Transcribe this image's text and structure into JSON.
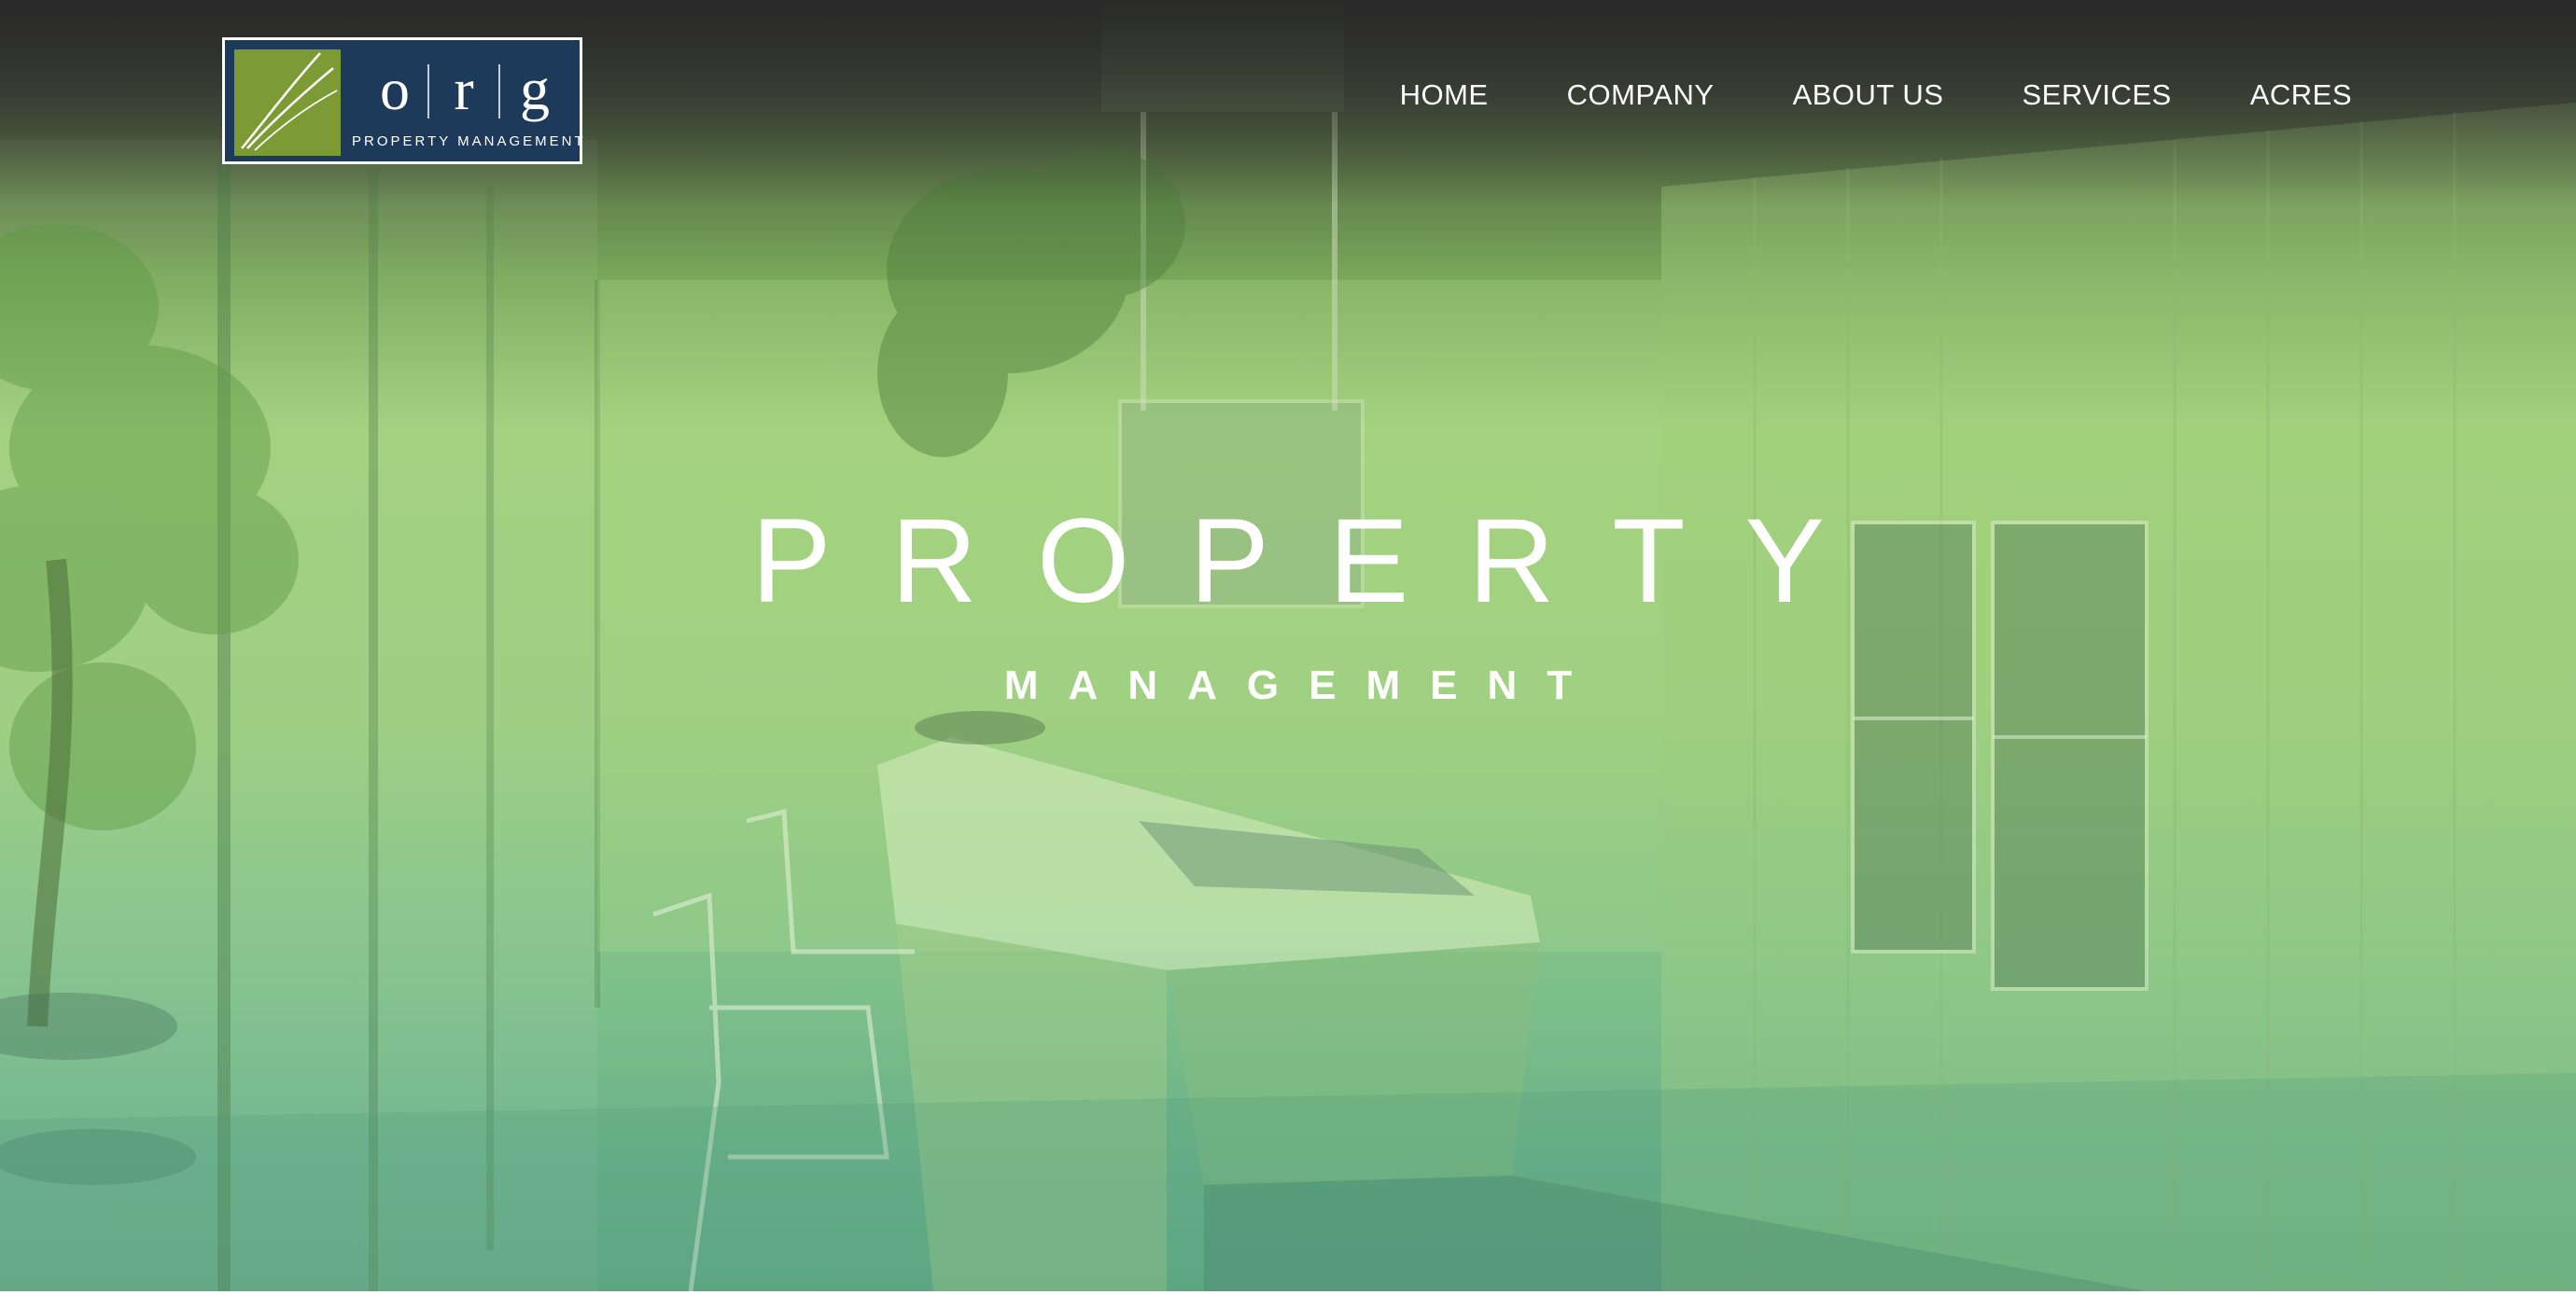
{
  "brand": {
    "logo_letters": [
      "o",
      "r",
      "g"
    ],
    "logo_subtitle": "PROPERTY MANAGEMENT",
    "mark_color": "#7c9b34",
    "badge_color": "#1d3a5a"
  },
  "nav": {
    "items": [
      {
        "label": "HOME"
      },
      {
        "label": "COMPANY"
      },
      {
        "label": "ABOUT US"
      },
      {
        "label": "SERVICES"
      },
      {
        "label": "ACRES"
      }
    ]
  },
  "hero": {
    "title": "PROPERTY",
    "subtitle": "MANAGEMENT",
    "overlay_color": "#9fcf79"
  }
}
